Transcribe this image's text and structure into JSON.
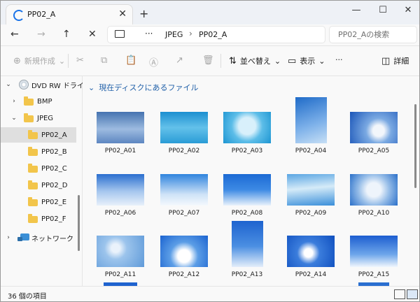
{
  "window": {
    "tab_title": "PP02_A",
    "new_tab": "+",
    "tab_close": "✕",
    "controls": {
      "minimize": "—",
      "maximize": "☐",
      "close": "✕"
    }
  },
  "nav": {
    "back": "←",
    "forward": "→",
    "up": "↑",
    "cancel": "✕",
    "ellipsis": "···",
    "breadcrumbs": [
      "JPEG",
      "PP02_A"
    ],
    "separator": "›",
    "search_placeholder": "PP02_Aの検索"
  },
  "commands": {
    "new_item": "新規作成",
    "new_icon": "⊕",
    "dropdown": "⌄",
    "sort": "並べ替え",
    "sort_icon": "⇅",
    "view": "表示",
    "view_icon": "▭",
    "more": "···",
    "details": "詳細",
    "details_icon": "◫",
    "icons": {
      "cut": "✂",
      "copy": "⧉",
      "paste": "📋",
      "rename": "Ⓐ",
      "share": "↗",
      "delete": "🗑"
    }
  },
  "sidebar": {
    "items": [
      {
        "label": "DVD RW ドライブ",
        "chevron": "⌄",
        "type": "drive"
      },
      {
        "label": "BMP",
        "chevron": "›",
        "type": "folder"
      },
      {
        "label": "JPEG",
        "chevron": "⌄",
        "type": "folder"
      },
      {
        "label": "PP02_A",
        "chevron": "",
        "type": "folder"
      },
      {
        "label": "PP02_B",
        "chevron": "",
        "type": "folder"
      },
      {
        "label": "PP02_C",
        "chevron": "",
        "type": "folder"
      },
      {
        "label": "PP02_D",
        "chevron": "",
        "type": "folder"
      },
      {
        "label": "PP02_E",
        "chevron": "",
        "type": "folder"
      },
      {
        "label": "PP02_F",
        "chevron": "",
        "type": "folder"
      },
      {
        "label": "ネットワーク",
        "chevron": "›",
        "type": "network"
      }
    ]
  },
  "main": {
    "group_chevron": "⌄",
    "group_header": "現在ディスクにあるファイル",
    "files": [
      "PP02_A01",
      "PP02_A02",
      "PP02_A03",
      "PP02_A04",
      "PP02_A05",
      "PP02_A06",
      "PP02_A07",
      "PP02_A08",
      "PP02_A09",
      "PP02_A10",
      "PP02_A11",
      "PP02_A12",
      "PP02_A13",
      "PP02_A14",
      "PP02_A15"
    ]
  },
  "status": {
    "item_count": "36 個の項目"
  },
  "colors": {
    "accent": "#1a73e8",
    "folder": "#f2c54b",
    "group_header": "#1f5fa8",
    "selected_row": "#dfdfdf"
  }
}
